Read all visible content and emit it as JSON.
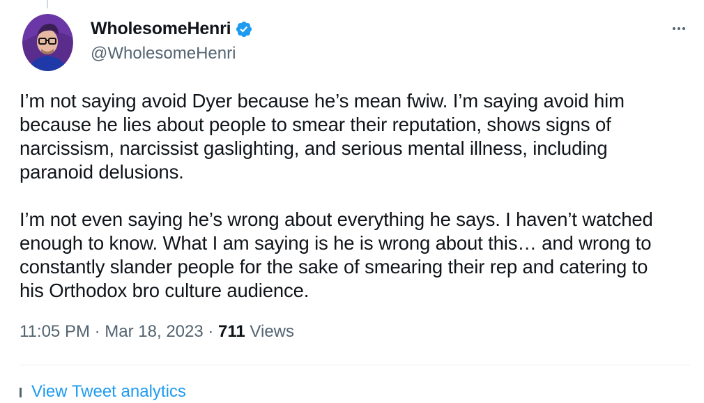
{
  "author": {
    "display_name": "WholesomeHenri",
    "handle": "@WholesomeHenri",
    "verified": true,
    "verified_color": "#1d9bf0"
  },
  "tweet": {
    "paragraphs": [
      "I’m not saying avoid Dyer because he’s mean fwiw. I’m saying avoid him\nbecause he lies about people to smear their reputation, shows signs of\nnarcissism, narcissist gaslighting, and serious mental illness, including\nparanoid delusions.",
      "I’m not even saying he’s wrong about everything he says. I haven’t watched\nenough to know. What I am saying is he is wrong about this… and wrong to\nconstantly slander people for the sake of smearing their rep and catering to\nhis Orthodox bro culture audience."
    ],
    "time": "11:05 PM",
    "date": "Mar 18, 2023",
    "separator": " · ",
    "views_count": "711",
    "views_label": " Views"
  },
  "actions": {
    "more_icon": "more-horizontal-icon",
    "translate_label": "View Tweet analytics"
  },
  "colors": {
    "text": "#0f1419",
    "secondary": "#536471",
    "accent": "#1d9bf0",
    "divider": "#e6ecf0"
  }
}
